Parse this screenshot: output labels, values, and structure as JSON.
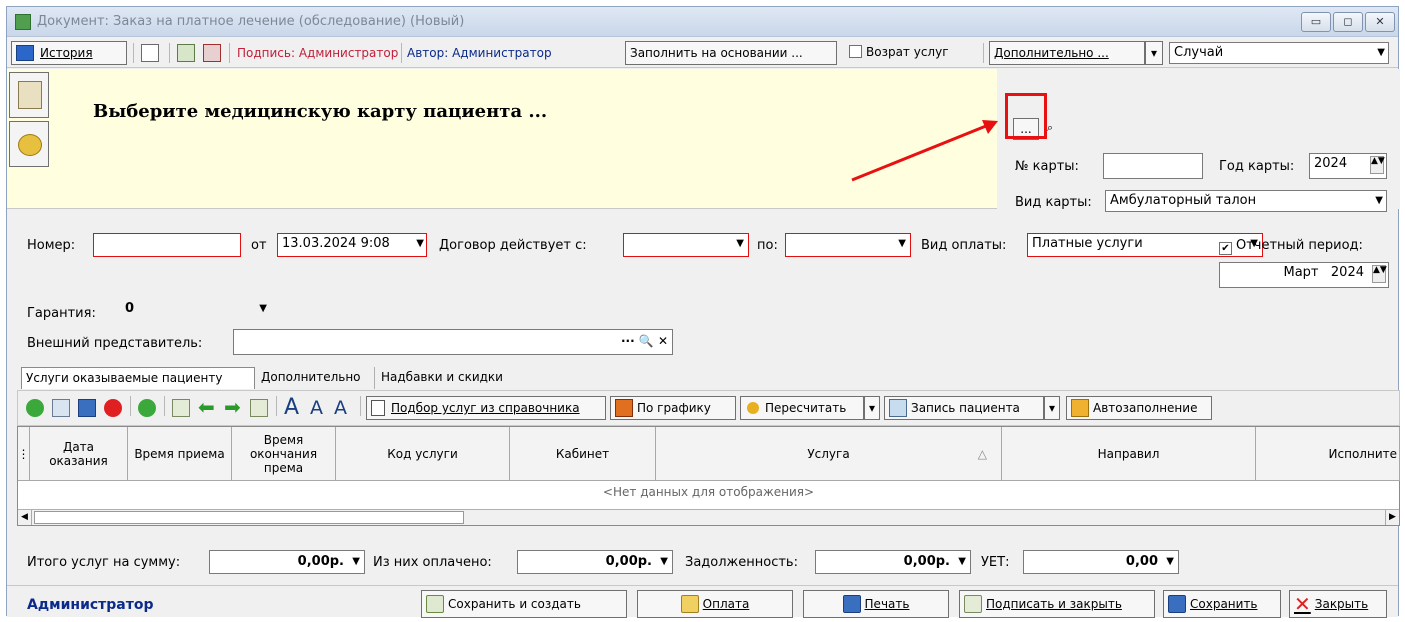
{
  "window": {
    "title": "Документ: Заказ на платное лечение (обследование) (Новый)",
    "btn_min": "▭",
    "btn_max": "◻",
    "btn_close": "✕"
  },
  "toolbar": {
    "history": "История",
    "signature": "Подпись: Администратор",
    "author": "Автор: Администратор",
    "fill_basis": "Заполнить на основании ...",
    "return_services": "Возрат услуг",
    "additional": "Дополнительно ...",
    "case_value": "Случай"
  },
  "prompt": {
    "text": "Выберите медицинскую карту пациента ..."
  },
  "card": {
    "ellipsis": "...",
    "search": "🔍",
    "number_label": "№ карты:",
    "number_value": "",
    "year_label": "Год карты:",
    "year_value": "2024",
    "type_label": "Вид карты:",
    "type_value": "Амбулаторный талон"
  },
  "order": {
    "number_label": "Номер:",
    "number_value": "",
    "from_label": "от",
    "from_value": "13.03.2024 9:08",
    "contract_label": "Договор действует с:",
    "contract_from": "",
    "to_label": "по:",
    "contract_to": "",
    "payment_label": "Вид оплаты:",
    "payment_value": "Платные услуги",
    "period_label": "Отчетный период:",
    "period_month": "Март",
    "period_year": "2024",
    "guarantee_label": "Гарантия:",
    "guarantee_value": "0",
    "ext_rep_label": "Внешний представитель:",
    "ext_rep_value": "",
    "ext_rep_actions": "··· 🔍 ✕"
  },
  "tabs": [
    "Услуги оказываемые пациенту",
    "Дополнительно",
    "Надбавки и скидки"
  ],
  "toolbar2": {
    "pick_services": "Подбор услуг из справочника",
    "by_schedule": "По графику",
    "recalc": "Пересчитать",
    "patient_record": "Запись пациента",
    "autofill": "Автозаполнение",
    "font_big": "A",
    "font_small": "A",
    "font_reset": "A"
  },
  "grid": {
    "columns": [
      "Дата оказания",
      "Время приема",
      "Время окончания према",
      "Код услуги",
      "Кабинет",
      "Услуга",
      "Направил",
      "Исполните"
    ],
    "empty_text": "<Нет данных для отображения>",
    "sort_indicator": "△"
  },
  "totals": {
    "sum_label": "Итого услуг на сумму:",
    "sum_value": "0,00р.",
    "paid_label": "Из них оплачено:",
    "paid_value": "0,00р.",
    "debt_label": "Задолженность:",
    "debt_value": "0,00р.",
    "uet_label": "УЕТ:",
    "uet_value": "0,00"
  },
  "bottom": {
    "user": "Администратор",
    "save_create": "Сохранить и создать",
    "payment": "Оплата",
    "print": "Печать",
    "sign_close": "Подписать и закрыть",
    "save": "Сохранить",
    "close": "Закрыть"
  },
  "colors": {
    "accent_red": "#e81010",
    "prompt_bg": "#ffffe0",
    "user_blue": "#0b2a8a"
  }
}
